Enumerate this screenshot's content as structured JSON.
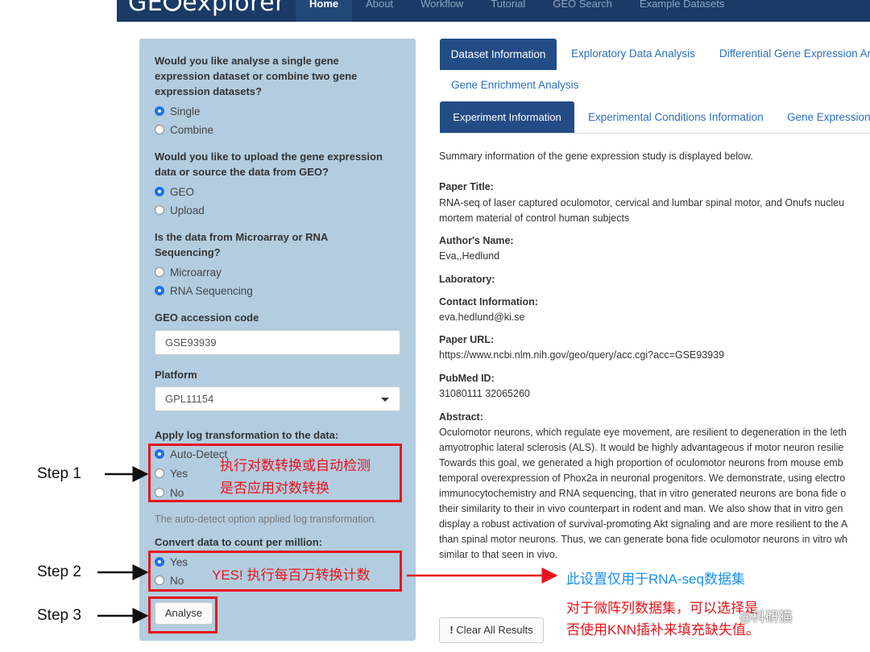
{
  "navbar": {
    "brand_left": "GE",
    "brand_right": "explorer",
    "items": [
      "Home",
      "About",
      "Workflow",
      "Tutorial",
      "GEO Search",
      "Example Datasets"
    ],
    "active_index": 0
  },
  "sidebar": {
    "q1": {
      "title": "Would you like analyse a single gene expression dataset or combine two gene expression datasets?",
      "options": [
        "Single",
        "Combine"
      ],
      "selected": "Single"
    },
    "q2": {
      "title": "Would you like to upload the gene expression data or source the data from GEO?",
      "options": [
        "GEO",
        "Upload"
      ],
      "selected": "GEO"
    },
    "q3": {
      "title": "Is the data from Microarray or RNA Sequencing?",
      "options": [
        "Microarray",
        "RNA Sequencing"
      ],
      "selected": "RNA Sequencing"
    },
    "geo_code": {
      "label": "GEO accession code",
      "value": "GSE93939"
    },
    "platform": {
      "label": "Platform",
      "value": "GPL11154"
    },
    "log": {
      "title": "Apply log transformation to the data:",
      "options": [
        "Auto-Detect",
        "Yes",
        "No"
      ],
      "selected": "Auto-Detect",
      "help": "The auto-detect option applied log transformation."
    },
    "cpm": {
      "title": "Convert data to count per million:",
      "options": [
        "Yes",
        "No"
      ],
      "selected": "Yes"
    },
    "analyse_label": "Analyse"
  },
  "main": {
    "tabs": [
      "Dataset Information",
      "Exploratory Data Analysis",
      "Differential Gene Expression An",
      "Gene Enrichment Analysis"
    ],
    "subtabs": [
      "Experiment Information",
      "Experimental Conditions Information",
      "Gene Expression"
    ],
    "summary": "Summary information of the gene expression study is displayed below.",
    "paper_title_label": "Paper Title:",
    "paper_title_line1": "RNA-seq of laser captured oculomotor, cervical and lumbar spinal motor, and Onufs nucleu",
    "paper_title_line2": "mortem material of control human subjects",
    "author_label": "Author's Name:",
    "author": "Eva,,Hedlund",
    "lab_label": "Laboratory:",
    "contact_label": "Contact Information:",
    "contact": "eva.hedlund@ki.se",
    "url_label": "Paper URL:",
    "url": "https://www.ncbi.nlm.nih.gov/geo/query/acc.cgi?acc=GSE93939",
    "pubmed_label": "PubMed ID:",
    "pubmed": "31080111 32065260",
    "abstract_label": "Abstract:",
    "abstract_lines": [
      "Oculomotor neurons, which regulate eye movement, are resilient to degeneration in the leth",
      "amyotrophic lateral sclerosis (ALS). It would be highly advantageous if motor neuron resilie",
      "Towards this goal, we generated a high proportion of oculomotor neurons from mouse emb",
      "temporal overexpression of Phox2a in neuronal progenitors. We demonstrate, using electro",
      "immunocytochemistry and RNA sequencing, that in vitro generated neurons are bona fide o",
      "their similarity to their in vivo counterpart in rodent and man. We also show that in vitro gen",
      "display a robust activation of survival-promoting Akt signaling and are more resilient to the A",
      "than spinal motor neurons. Thus, we can generate bona fide oculomotor neurons in vitro wh",
      "similar to that seen in vivo."
    ],
    "clear_label": "Clear All Results"
  },
  "annotations": {
    "step1": "Step 1",
    "step2": "Step 2",
    "step3": "Step 3",
    "note1_line1": "执行对数转换或自动检测",
    "note1_line2": "是否应用对数转换",
    "note2": "YES! 执行每百万转换计数",
    "note3": "此设置仅用于RNA-seq数据集",
    "note4_line1": "对于微阵列数据集，可以选择是",
    "note4_line2": "否使用KNN插补来填充缺失值。",
    "watermark": "科研猫"
  },
  "colors": {
    "navbar": "#1b3a66",
    "sidebar": "#b3cde0",
    "tab_active": "#234c86",
    "annotation_red": "#e8141b",
    "annotation_blue": "#1a8fe8"
  }
}
